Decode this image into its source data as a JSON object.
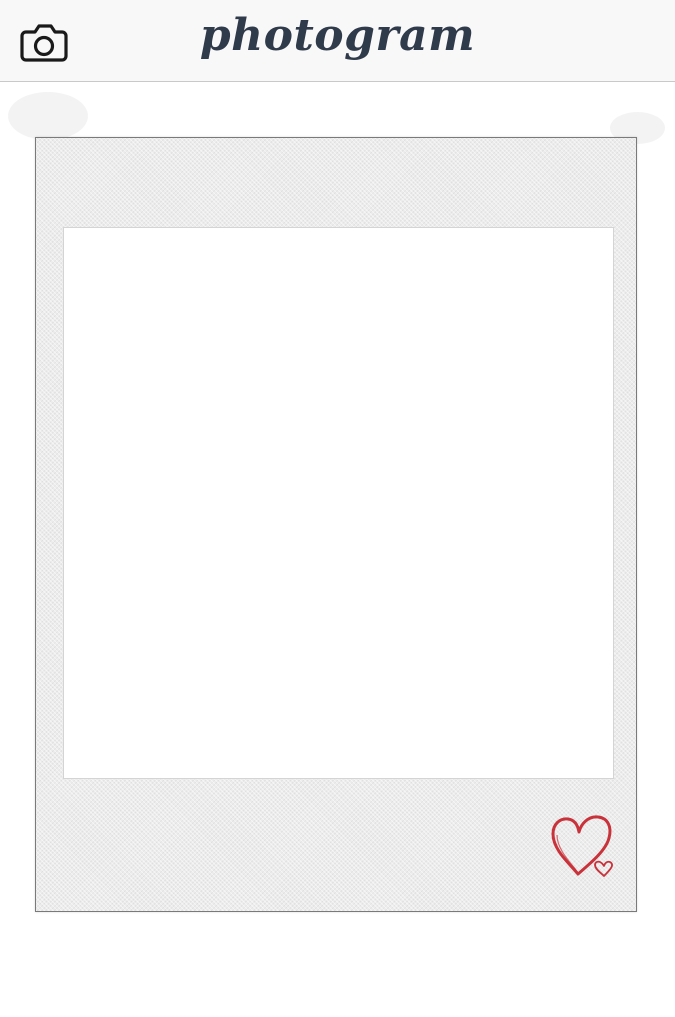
{
  "header": {
    "title": "photogram",
    "camera_icon": "camera-icon"
  },
  "post": {
    "photo_icon": "blank-photo",
    "like_icon": "heart-icon",
    "accent_color": "#c8323a"
  },
  "colors": {
    "title": "#2f3a4a",
    "frame": "#ececec",
    "header_bg": "#f8f8f8"
  }
}
